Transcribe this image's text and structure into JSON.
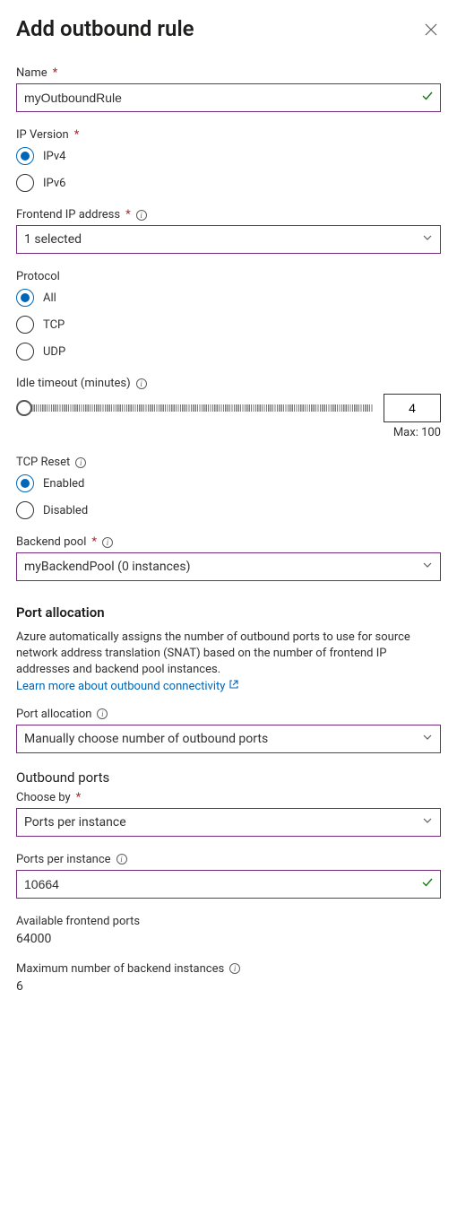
{
  "header": {
    "title": "Add outbound rule"
  },
  "name": {
    "label": "Name",
    "value": "myOutboundRule"
  },
  "ipVersion": {
    "label": "IP Version",
    "options": {
      "ipv4": "IPv4",
      "ipv6": "IPv6"
    }
  },
  "frontendIp": {
    "label": "Frontend IP address",
    "value": "1 selected"
  },
  "protocol": {
    "label": "Protocol",
    "options": {
      "all": "All",
      "tcp": "TCP",
      "udp": "UDP"
    }
  },
  "idleTimeout": {
    "label": "Idle timeout (minutes)",
    "value": "4",
    "maxLabel": "Max: 100"
  },
  "tcpReset": {
    "label": "TCP Reset",
    "options": {
      "enabled": "Enabled",
      "disabled": "Disabled"
    }
  },
  "backendPool": {
    "label": "Backend pool",
    "value": "myBackendPool (0 instances)"
  },
  "portAllocation": {
    "heading": "Port allocation",
    "description": "Azure automatically assigns the number of outbound ports to use for source network address translation (SNAT) based on the number of frontend IP addresses and backend pool instances.",
    "linkText": "Learn more about outbound connectivity",
    "label": "Port allocation",
    "value": "Manually choose number of outbound ports"
  },
  "outboundPorts": {
    "heading": "Outbound ports",
    "chooseByLabel": "Choose by",
    "chooseByValue": "Ports per instance",
    "portsPerInstanceLabel": "Ports per instance",
    "portsPerInstanceValue": "10664",
    "availLabel": "Available frontend ports",
    "availValue": "64000",
    "maxBackendLabel": "Maximum number of backend instances",
    "maxBackendValue": "6"
  }
}
